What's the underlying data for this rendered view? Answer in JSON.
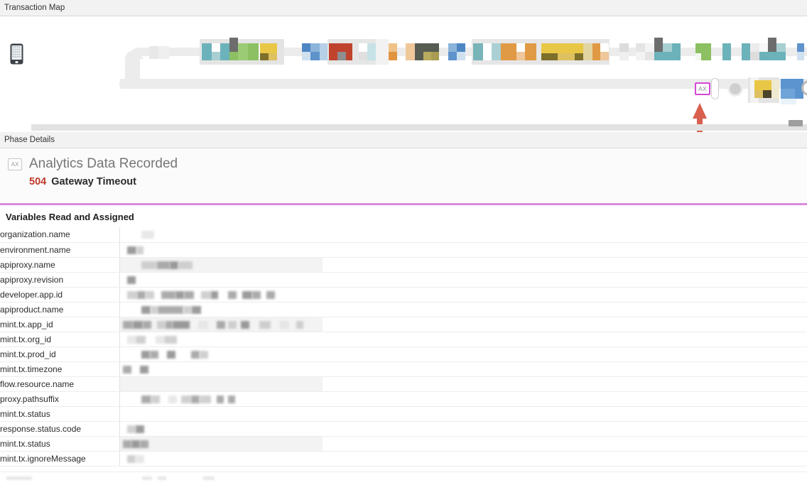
{
  "sections": {
    "transaction_map_label": "Transaction Map",
    "phase_details_label": "Phase Details"
  },
  "map": {
    "client_icon": "mobile-phone-icon",
    "selected_node_badge": "AX",
    "selected_node_border_color": "#d648d6",
    "pointer_arrow_color": "#d9604f",
    "scrollbar_present": true
  },
  "phase": {
    "badge": "AX",
    "title": "Analytics Data Recorded",
    "status_code": "504",
    "status_text": "Gateway Timeout",
    "accent_color": "#d98bdd",
    "error_color": "#c0392b"
  },
  "variables": {
    "title": "Variables Read and Assigned",
    "rows": [
      {
        "name": "organization.name"
      },
      {
        "name": "environment.name"
      },
      {
        "name": "apiproxy.name"
      },
      {
        "name": "apiproxy.revision"
      },
      {
        "name": "developer.app.id"
      },
      {
        "name": "apiproduct.name"
      },
      {
        "name": "mint.tx.app_id"
      },
      {
        "name": "mint.tx.org_id"
      },
      {
        "name": "mint.tx.prod_id"
      },
      {
        "name": "mint.tx.timezone"
      },
      {
        "name": "flow.resource.name"
      },
      {
        "name": "proxy.pathsuffix"
      },
      {
        "name": "mint.tx.status"
      },
      {
        "name": "response.status.code"
      },
      {
        "name": "mint.tx.status"
      },
      {
        "name": "mint.tx.ignoreMessage"
      }
    ]
  }
}
